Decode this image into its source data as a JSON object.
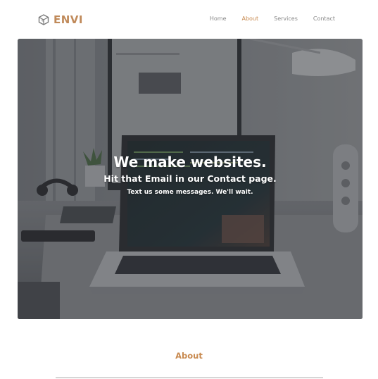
{
  "brand": {
    "name": "ENVI",
    "logo_icon": "cube-icon",
    "color": "#c08a5a"
  },
  "nav": {
    "items": [
      {
        "label": "Home",
        "active": false
      },
      {
        "label": "About",
        "active": true
      },
      {
        "label": "Services",
        "active": false
      },
      {
        "label": "Contact",
        "active": false
      }
    ],
    "active_color": "#c88a50"
  },
  "hero": {
    "title": "We make websites.",
    "subtitle": "Hit that Email in our Contact page.",
    "note": "Text us some messages. We'll wait."
  },
  "about": {
    "heading": "About"
  }
}
